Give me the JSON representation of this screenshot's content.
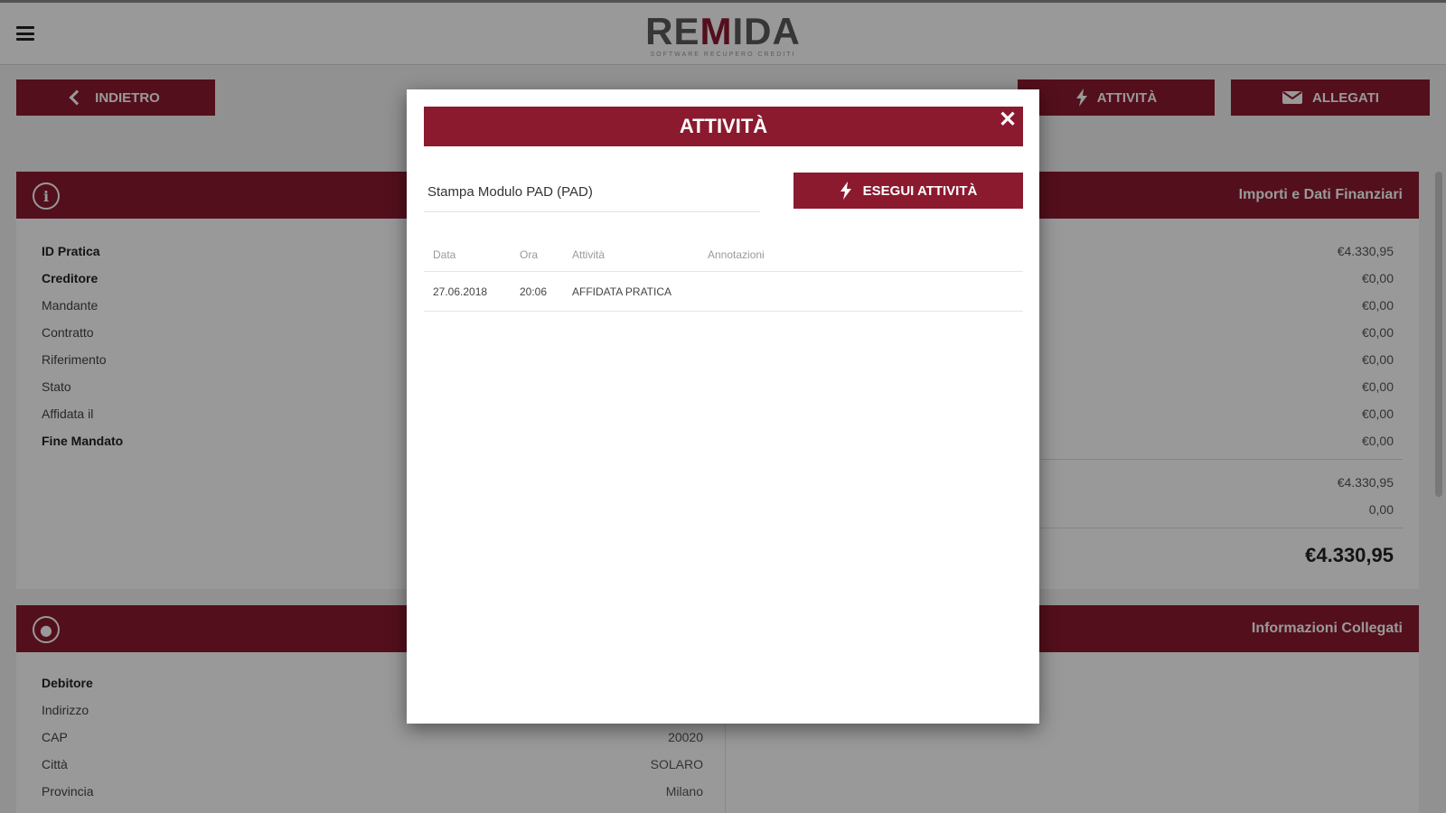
{
  "header": {
    "menu_icon": "hamburger-icon",
    "logo_main_left": "RE",
    "logo_main_m": "M",
    "logo_main_right": "IDA",
    "logo_sub": "SOFTWARE RECUPERO CREDITI"
  },
  "toolbar": {
    "back_label": "INDIETRO",
    "attivita_label": "ATTIVITÀ",
    "allegati_label": "ALLEGATI"
  },
  "card_pratica": {
    "icon": "info-icon",
    "right_title": "Importi e Dati Finanziari",
    "rows": [
      "ID Pratica",
      "Creditore",
      "Mandante",
      "Contratto",
      "Riferimento",
      "Stato",
      "Affidata il",
      "Fine Mandato"
    ],
    "amounts": [
      "€4.330,95",
      "€0,00",
      "€0,00",
      "€0,00",
      "€0,00",
      "€0,00",
      "€0,00",
      "€0,00",
      "€4.330,95",
      "0,00"
    ],
    "total": "€4.330,95"
  },
  "card_debitore": {
    "icon": "user-icon",
    "right_title": "Informazioni Collegati",
    "rows": [
      "Debitore",
      "Indirizzo",
      "CAP",
      "Città",
      "Provincia"
    ],
    "values": [
      "",
      "",
      "20020",
      "SOLARO",
      "Milano"
    ]
  },
  "modal": {
    "title": "ATTIVITÀ",
    "close": "✕",
    "select_value": "Stampa Modulo PAD (PAD)",
    "run_label": "ESEGUI ATTIVITÀ",
    "columns": [
      "Data",
      "Ora",
      "Attività",
      "Annotazioni"
    ],
    "rows": [
      {
        "data": "27.06.2018",
        "ora": "20:06",
        "attivita": "AFFIDATA PRATICA",
        "annotazioni": ""
      }
    ]
  },
  "colors": {
    "brand": "#8b1a2f",
    "overlay": "rgba(0,0,0,0.40)"
  }
}
